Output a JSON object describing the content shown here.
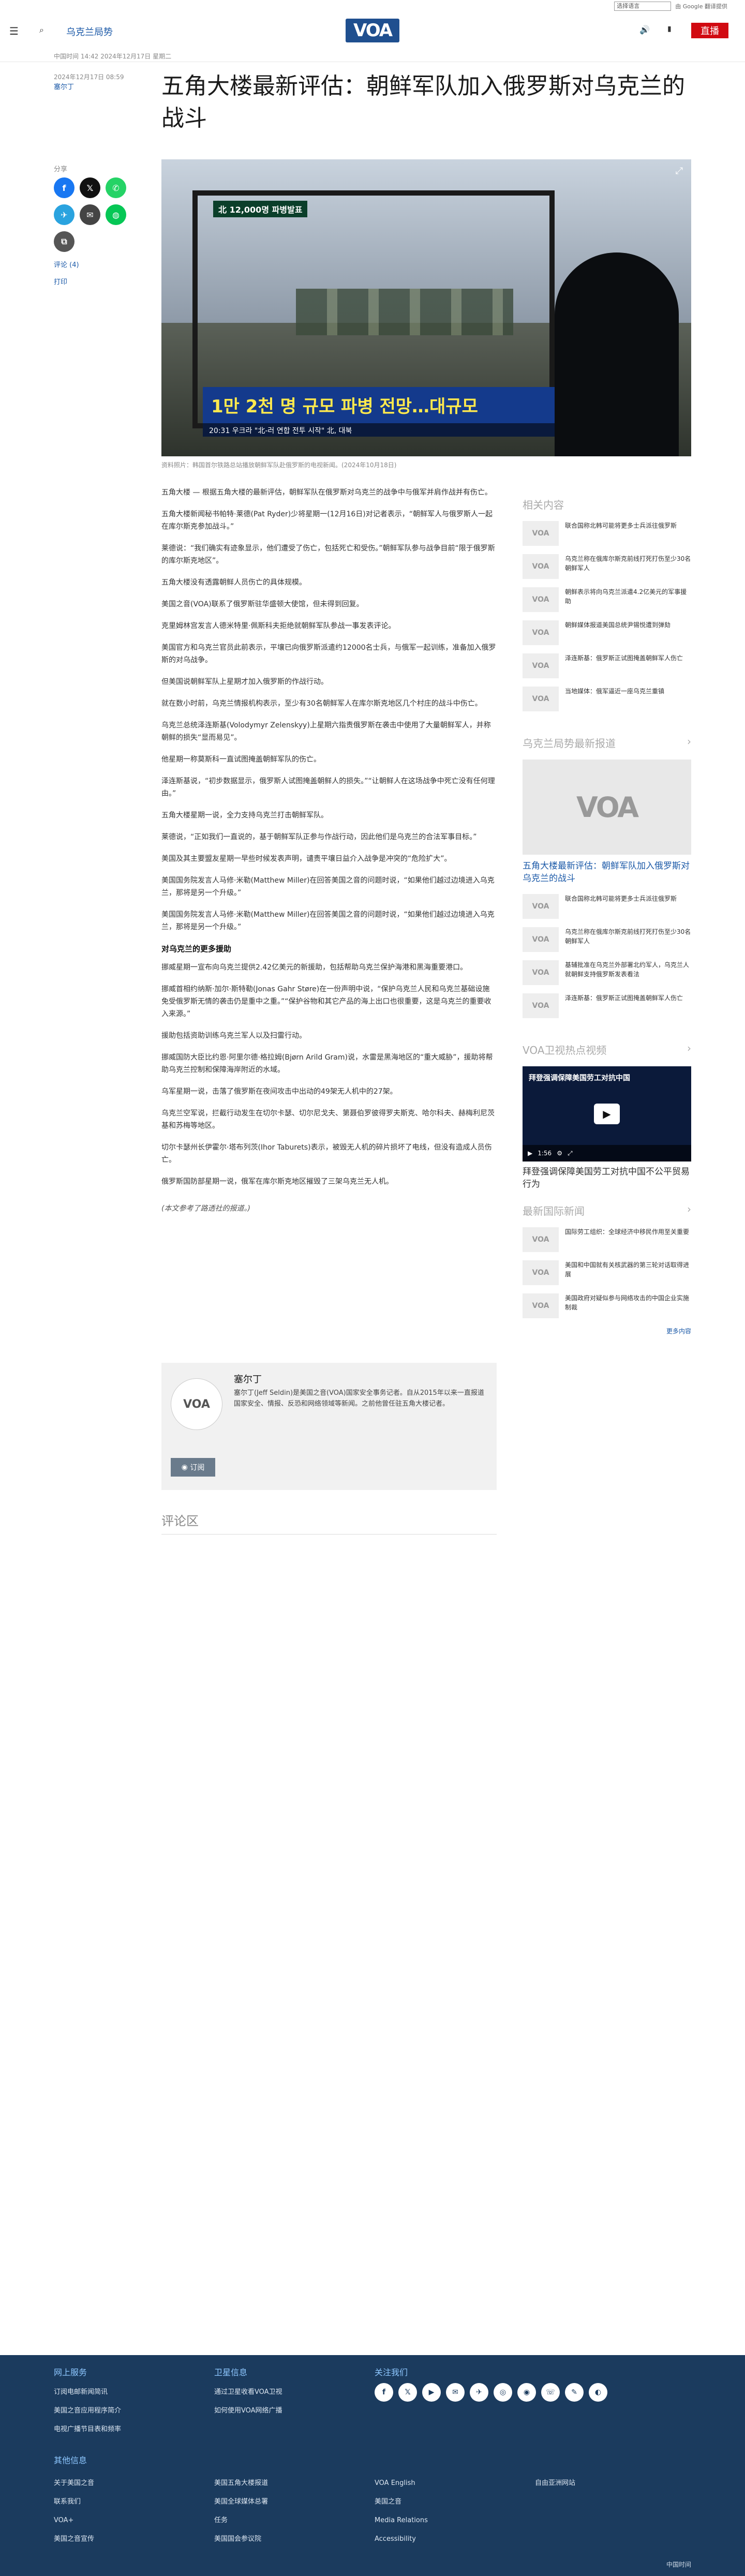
{
  "utility": {
    "language_select": "选择语言",
    "translate": "由 Google 翻译提供"
  },
  "header": {
    "section": "乌克兰局势",
    "logo": "VOA",
    "live": "直播"
  },
  "article": {
    "date_line": "中国时间 14:42 2024年12月17日 星期二",
    "updated": "2024年12月17日 08:59",
    "author": "塞尔丁",
    "title": "五角大楼最新评估：朝鲜军队加入俄罗斯对乌克兰的战斗",
    "hero_overlay_tag": "北 12,000명 파병발표",
    "hero_caption_korean": "1만 2천 명 규모 파병 전망…대규모 ",
    "hero_ticker": "20:31  우크라 \"北-러 연합 전투 시작\"  北, 대북",
    "image_caption": "资料照片：韩国首尔铁路总站播放朝鲜军队赴俄罗斯的电视新闻。(2024年10月18日)",
    "paragraphs": [
      "五角大楼 — 根据五角大楼的最新评估，朝鲜军队在俄罗斯对乌克兰的战争中与俄军并肩作战并有伤亡。",
      "五角大楼新闻秘书帕特·莱德(Pat Ryder)少将星期一(12月16日)对记者表示，“朝鲜军人与俄罗斯人一起在库尔斯克参加战斗。”",
      "莱德说：“我们确实有迹象显示，他们遭受了伤亡，包括死亡和受伤。”朝鲜军队参与战争目前“限于俄罗斯的库尔斯克地区”。",
      "五角大楼没有透露朝鲜人员伤亡的具体规模。",
      "美国之音(VOA)联系了俄罗斯驻华盛顿大使馆，但未得到回复。",
      "克里姆林宫发言人德米特里·佩斯科夫拒绝就朝鲜军队参战一事发表评论。",
      "美国官方和乌克兰官员此前表示，平壤已向俄罗斯派遣约12000名士兵，与俄军一起训练，准备加入俄罗斯的对乌战争。",
      "但美国说朝鲜军队上星期才加入俄罗斯的作战行动。",
      "就在数小时前，乌克兰情报机构表示，至少有30名朝鲜军人在库尔斯克地区几个村庄的战斗中伤亡。",
      "乌克兰总统泽连斯基(Volodymyr Zelenskyy)上星期六指责俄罗斯在袭击中使用了大量朝鲜军人，并称朝鲜的损失“显而易见”。",
      "他星期一称莫斯科一直试图掩盖朝鲜军队的伤亡。",
      "泽连斯基说，“初步数据显示，俄罗斯人试图掩盖朝鲜人的损失。”“让朝鲜人在这场战争中死亡没有任何理由。”",
      "五角大楼星期一说，全力支持乌克兰打击朝鲜军队。",
      "莱德说，“正如我们一直说的，基于朝鲜军队正参与作战行动，因此他们是乌克兰的合法军事目标。”",
      "美国及其主要盟友星期一早些时候发表声明，谴责平壤日益介入战争是冲突的“危险扩大”。",
      "美国国务院发言人马修·米勒(Matthew Miller)在回答美国之音的问题时说，“如果他们越过边境进入乌克兰，那将是另一个升级。”",
      "美国国务院发言人马修·米勒(Matthew Miller)在回答美国之音的问题时说，“如果他们越过边境进入乌克兰，那将是另一个升级。”"
    ],
    "subhead": "对乌克兰的更多援助",
    "paragraphs2": [
      "挪威星期一宣布向乌克兰提供2.42亿美元的新援助，包括帮助乌克兰保护海港和黑海重要港口。",
      "挪威首相约纳斯·加尔·斯特勒(Jonas Gahr Støre)在一份声明中说，“保护乌克兰人民和乌克兰基础设施免受俄罗斯无情的袭击仍是重中之重。”“保护谷物和其它产品的海上出口也很重要，这是乌克兰的重要收入来源。”",
      "援助包括资助训练乌克兰军人以及扫雷行动。",
      "挪威国防大臣比约恩·阿里尔德·格拉姆(Bjørn Arild Gram)说，水雷是黑海地区的“重大威胁”，援助将帮助乌克兰控制和保障海岸附近的水域。",
      "乌军星期一说，击落了俄罗斯在夜间攻击中出动的49架无人机中的27架。",
      "乌克兰空军说，拦截行动发生在切尔卡瑟、切尔尼戈夫、第聂伯罗彼得罗夫斯克、哈尔科夫、赫梅利尼茨基和苏梅等地区。",
      "切尔卡瑟州长伊霍尔·塔布列茨(Ihor Taburets)表示，被毁无人机的碎片损坏了电线，但没有造成人员伤亡。",
      "俄罗斯国防部星期一说，俄军在库尔斯克地区摧毁了三架乌克兰无人机。"
    ],
    "footnote": "(本文参考了路透社的报道。)"
  },
  "share": {
    "label": "分享",
    "comments": "评论 (4)",
    "print": "打印"
  },
  "author_box": {
    "avatar": "VOA",
    "name": "塞尔丁",
    "bio": "塞尔丁(Jeff Seldin)是美国之音(VOA)国家安全事务记者。自从2015年以来一直报道国家安全、情报、反恐和网络领域等新闻。之前他曾任驻五角大楼记者。",
    "subscribe": "订阅"
  },
  "comments_title": "评论区",
  "sidebar": {
    "related_title": "相关内容",
    "related": [
      "联合国称北韩可能将更多士兵派往俄罗斯",
      "乌克兰称在俄库尔斯克前线打死打伤至少30名朝鲜军人",
      "朝鲜表示将向乌克兰派遣4.2亿美元的军事援助",
      "朝鲜媒体报道美国总统尹锡悦遭到弹劾",
      "泽连斯基：俄罗斯正试图掩盖朝鲜军人伤亡",
      "当地媒体：俄军逼近一座乌克兰重镇"
    ],
    "latest_title": "乌克兰局势最新报道",
    "feature_title": "五角大楼最新评估：朝鲜军队加入俄罗斯对乌克兰的战斗",
    "latest": [
      "联合国称北韩可能将更多士兵派往俄罗斯",
      "乌克兰称在俄库尔斯克前线打死打伤至少30名朝鲜军人",
      "基辅批准在乌克兰外部署北约军人，乌克兰人就朝鲜支持俄罗斯发表看法",
      "泽连斯基：俄罗斯正试图掩盖朝鲜军人伤亡"
    ],
    "video_section": "VOA卫视热点视频",
    "video_overlay": "拜登强调保障美国劳工对抗中国",
    "video_time": "1:56",
    "video_title": "拜登强调保障美国劳工对抗中国不公平贸易行为",
    "intl_title": "最新国际新闻",
    "intl": [
      "国际劳工组织：全球经济中移民作用至关重要",
      "美国和中国就有关核武器的第三轮对话取得进展",
      "美国政府对疑似参与网络攻击的中国企业实施制裁"
    ],
    "more": "更多内容"
  },
  "footer": {
    "online_title": "网上服务",
    "online": [
      "订阅电邮新闻简讯",
      "美国之音应用程序简介",
      "电视广播节目表和频率"
    ],
    "satellite_title": "卫星信息",
    "satellite": [
      "通过卫星收看VOA卫视",
      "如何使用VOA网络广播"
    ],
    "follow_title": "关注我们",
    "social": [
      "f",
      "𝕏",
      "▶",
      "✉",
      "✈",
      "◎",
      "◉",
      "☏",
      "✎",
      "◐"
    ],
    "other_title": "其他信息",
    "other": [
      "关于美国之音",
      "美国五角大楼报道",
      "VOA English",
      "自由亚洲网站",
      "联系我们",
      "美国全球媒体总署",
      "美国之音",
      "",
      "VOA+",
      "任务",
      "Media Relations",
      "",
      "美国之音宣传",
      "美国国会参议院",
      "Accessibility",
      ""
    ],
    "copyright": "中国时间"
  }
}
